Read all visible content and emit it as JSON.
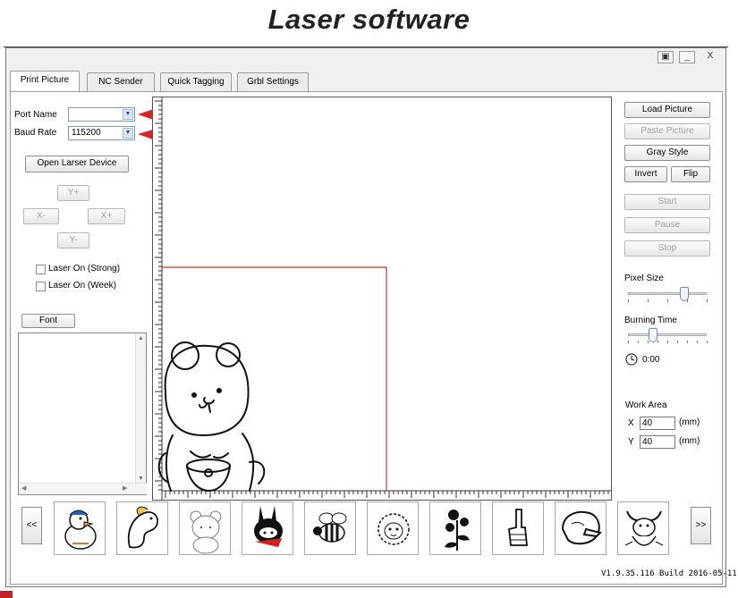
{
  "caption": "Laser software",
  "window": {
    "controls": [
      "▣",
      "_",
      "X"
    ],
    "tabs": [
      "Print Picture",
      "NC Sender",
      "Quick Tagging",
      "Grbl Settings"
    ],
    "active_tab": "Print Picture",
    "version": "V1.9.35.116 Build 2016-05-11"
  },
  "left": {
    "port_label": "Port Name",
    "port_value": "",
    "baud_label": "Baud Rate",
    "baud_value": "115200",
    "open_button": "Open Larser Device",
    "yplus": "Y+",
    "xminus": "X-",
    "xplus": "X+",
    "yminus": "Y-",
    "laser_strong": "Laser On (Strong)",
    "laser_week": "Laser On (Week)",
    "font_button": "Font",
    "text_value": ""
  },
  "right": {
    "load": "Load Picture",
    "paste": "Paste Picture",
    "gray": "Gray Style",
    "invert": "Invert",
    "flip": "Flip",
    "start": "Start",
    "pause": "Pause",
    "stop": "Stop",
    "pixel_size_label": "Pixel Size",
    "pixel_size_level": 0.72,
    "burning_time_label": "Burning Time",
    "burning_time_level": 0.32,
    "time": "0:00",
    "work_area_label": "Work Area",
    "x_label": "X",
    "x_value": "40",
    "y_label": "Y",
    "y_value": "40",
    "unit": "(mm)"
  },
  "thumbnails": {
    "prev": "<<",
    "next": ">>",
    "items": [
      "duck-icon",
      "horse-icon",
      "bear-icon",
      "ninja-bunny-icon",
      "bee-icon",
      "sheep-icon",
      "flower-icon",
      "fist-icon",
      "pointing-hand-icon",
      "bull-icon"
    ]
  },
  "colors": {
    "work_area_outline": "#c0392b",
    "annotation_arrow": "#e02020"
  }
}
